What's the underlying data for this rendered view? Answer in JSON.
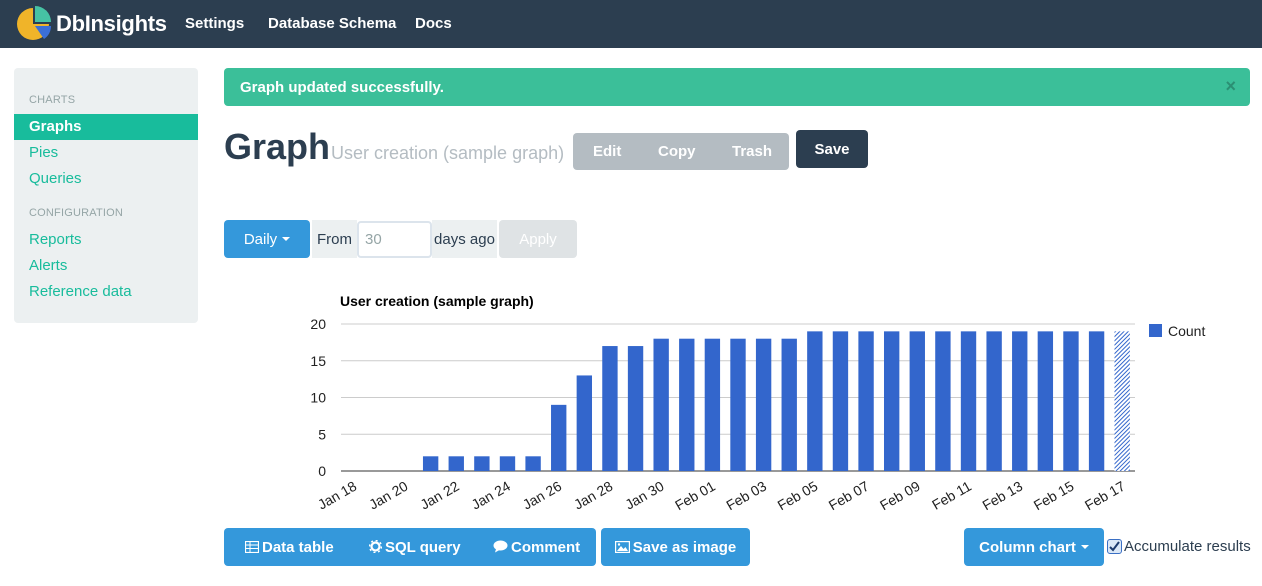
{
  "app": {
    "name": "DbInsights"
  },
  "nav": [
    {
      "label": "Settings"
    },
    {
      "label": "Database Schema"
    },
    {
      "label": "Docs"
    }
  ],
  "sidebar": {
    "charts_header": "CHARTS",
    "charts_items": [
      {
        "label": "Graphs",
        "active": true
      },
      {
        "label": "Pies"
      },
      {
        "label": "Queries"
      }
    ],
    "config_header": "CONFIGURATION",
    "config_items": [
      {
        "label": "Reports"
      },
      {
        "label": "Alerts"
      },
      {
        "label": "Reference data"
      }
    ]
  },
  "alert": {
    "message": "Graph updated successfully.",
    "close": "×"
  },
  "page": {
    "title": "Graph",
    "subtitle": "User creation (sample graph)",
    "actions": {
      "edit": "Edit",
      "copy": "Copy",
      "trash": "Trash"
    },
    "save": "Save"
  },
  "period": {
    "granularity": "Daily",
    "from_label": "From",
    "days_value": "",
    "days_placeholder": "30",
    "days_ago_label": "days ago",
    "apply": "Apply"
  },
  "colors": {
    "navbar": "#2c3e50",
    "accent": "#18bc9c",
    "primary": "#3498db",
    "bar": "#3366cc"
  },
  "chart_data": {
    "type": "bar",
    "title": "User creation (sample graph)",
    "ylim": [
      0,
      20
    ],
    "y_ticks": [
      0,
      5,
      10,
      15,
      20
    ],
    "x": [
      "Jan 18",
      "Jan 19",
      "Jan 20",
      "Jan 21",
      "Jan 22",
      "Jan 23",
      "Jan 24",
      "Jan 25",
      "Jan 26",
      "Jan 27",
      "Jan 28",
      "Jan 29",
      "Jan 30",
      "Jan 31",
      "Feb 01",
      "Feb 02",
      "Feb 03",
      "Feb 04",
      "Feb 05",
      "Feb 06",
      "Feb 07",
      "Feb 08",
      "Feb 09",
      "Feb 10",
      "Feb 11",
      "Feb 12",
      "Feb 13",
      "Feb 14",
      "Feb 15",
      "Feb 16",
      "Feb 17"
    ],
    "x_tick_labels": [
      "Jan 18",
      "Jan 20",
      "Jan 22",
      "Jan 24",
      "Jan 26",
      "Jan 28",
      "Jan 30",
      "Feb 01",
      "Feb 03",
      "Feb 05",
      "Feb 07",
      "Feb 09",
      "Feb 11",
      "Feb 13",
      "Feb 15",
      "Feb 17"
    ],
    "series": [
      {
        "name": "Count",
        "values": [
          0,
          0,
          0,
          2,
          2,
          2,
          2,
          2,
          9,
          13,
          17,
          17,
          18,
          18,
          18,
          18,
          18,
          18,
          19,
          19,
          19,
          19,
          19,
          19,
          19,
          19,
          19,
          19,
          19,
          19,
          19
        ]
      }
    ],
    "partial_last_period": true,
    "legend": "right",
    "grid": true
  },
  "bottom": {
    "data_table": "Data table",
    "sql_query": "SQL query",
    "comment": "Comment",
    "save_image": "Save as image",
    "chart_type": "Column chart",
    "accumulate": "Accumulate results",
    "accumulate_checked": true
  }
}
